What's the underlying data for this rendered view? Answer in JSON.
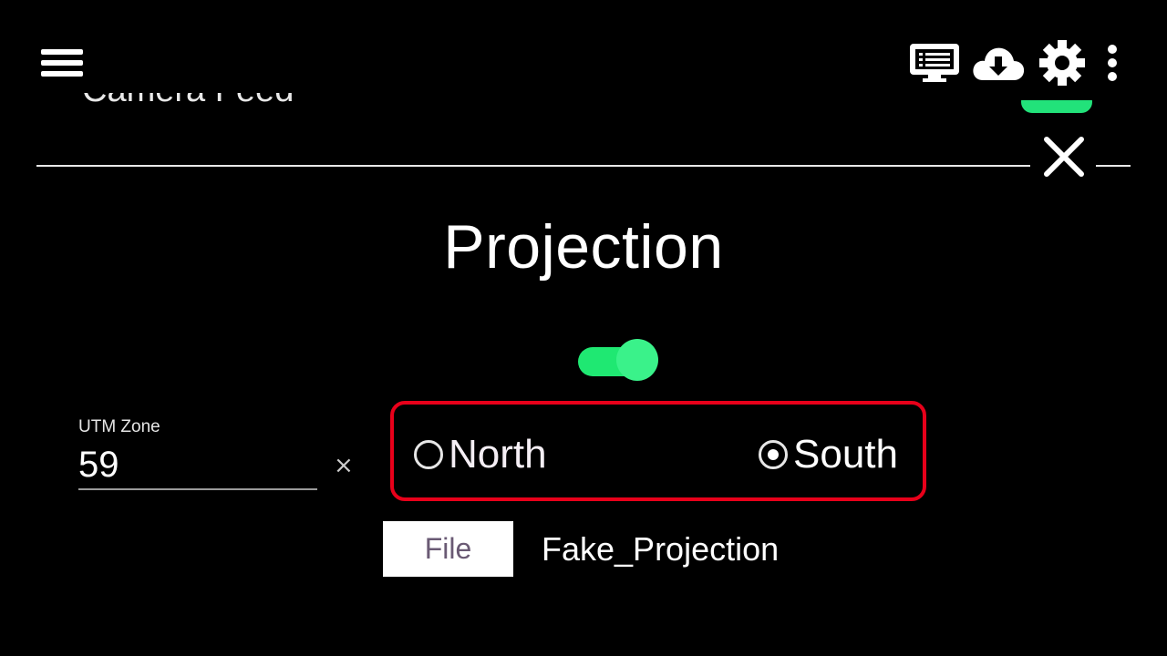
{
  "appbar": {
    "menu_icon": "hamburger-menu-icon",
    "actions": [
      {
        "icon": "monitor-list-icon"
      },
      {
        "icon": "cloud-download-icon"
      },
      {
        "icon": "gear-icon"
      },
      {
        "icon": "kebab-menu-icon"
      }
    ]
  },
  "previous_item": {
    "label": "Camera Feed",
    "toggle_on": true
  },
  "close_icon": "close-icon",
  "panel": {
    "title": "Projection",
    "enabled": true,
    "utm_zone": {
      "label": "UTM Zone",
      "value": "59",
      "clear_glyph": "×"
    },
    "hemisphere": {
      "options": [
        {
          "label": "North",
          "checked": false
        },
        {
          "label": "South",
          "checked": true
        }
      ]
    },
    "file": {
      "button_label": "File",
      "file_name": "Fake_Projection"
    }
  },
  "colors": {
    "background": "#000000",
    "toggle_green": "#22e27a",
    "highlight_red": "#e8001a",
    "text": "#ffffff"
  }
}
